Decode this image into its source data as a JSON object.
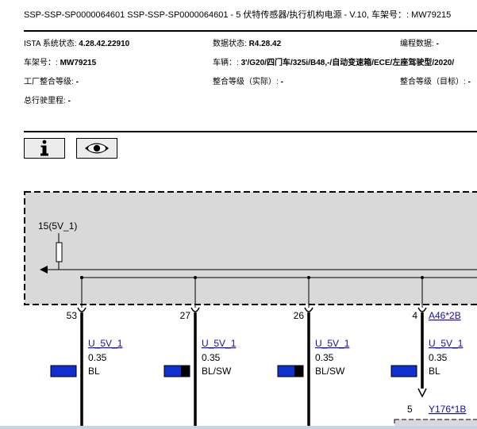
{
  "header": {
    "title": "SSP-SSP-SP0000064601 SSP-SSP-SP0000064601 - 5 伏特传感器/执行机构电源 - V.10, 车架号：: MW79215"
  },
  "info": {
    "ista_label": "ISTA 系统状态:",
    "ista_value": "4.28.42.22910",
    "data_label": "数据状态:",
    "data_value": "R4.28.42",
    "prog_label": "编程数据:",
    "prog_value": "-",
    "vin_label": "车架号：:",
    "vin_value": "MW79215",
    "vehicle_label": "车辆：:",
    "vehicle_value": "3'/G20/四门车/325i/B48,-/自动变速箱/ECE/左座驾驶型/2020/",
    "factory_label": "工厂整合等级:",
    "factory_value": "-",
    "actual_label": "整合等级（实际）:",
    "actual_value": "-",
    "target_label": "整合等级（目标）:",
    "target_value": "-",
    "mileage_label": "总行驶里程:",
    "mileage_value": "-"
  },
  "toolbar": {
    "info_icon": "info-icon",
    "eye_icon": "eye-icon"
  },
  "diagram": {
    "supply_label": "15(5V_1)",
    "pins": [
      {
        "pin": "53",
        "signal": "U_5V_1",
        "size": "0.35",
        "color": "BL"
      },
      {
        "pin": "27",
        "signal": "U_5V_1",
        "size": "0.35",
        "color": "BL/SW"
      },
      {
        "pin": "26",
        "signal": "U_5V_1",
        "size": "0.35",
        "color": "BL/SW"
      },
      {
        "pin": "4",
        "signal": "U_5V_1",
        "size": "0.35",
        "color": "BL"
      }
    ],
    "connector_top": "A46*2B",
    "connector_bottom": "Y176*1B",
    "connector_bottom_pin": "5",
    "colors": {
      "blue": "#1030d0",
      "black": "#000000",
      "box_fill": "#d9d9d9"
    }
  }
}
